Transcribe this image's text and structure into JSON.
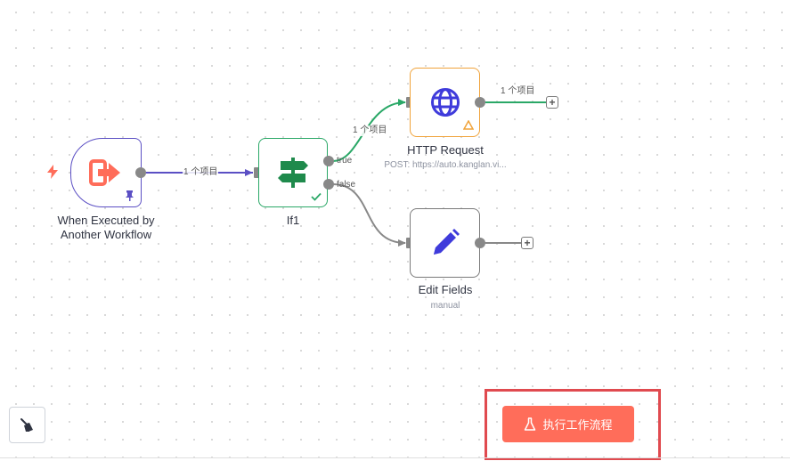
{
  "colors": {
    "trigger_border": "#5b4fc4",
    "if_border": "#2aa867",
    "http_border": "#f0a33a",
    "run_button": "#ff6d5a",
    "highlight": "#e04a4f",
    "success_edge": "#2aa867",
    "trigger_edge": "#5b4fc4"
  },
  "nodes": {
    "trigger": {
      "title_line1": "When Executed by",
      "title_line2": "Another Workflow",
      "icon": "sign-in-arrow-icon"
    },
    "if": {
      "title": "If1",
      "icon": "signpost-icon",
      "port_true": "true",
      "port_false": "false"
    },
    "http": {
      "title": "HTTP Request",
      "subtitle": "POST: https://auto.kanglan.vi...",
      "icon": "globe-icon"
    },
    "edit": {
      "title": "Edit Fields",
      "subtitle": "manual",
      "icon": "pencil-icon"
    }
  },
  "edges": {
    "trigger_to_if": "1 个项目",
    "if_true_to_http": "1 个项目",
    "http_out": "1 个项目"
  },
  "toolbar": {
    "run_workflow_label": "执行工作流程",
    "run_icon": "flask-icon",
    "tidy_icon": "broom-icon"
  }
}
